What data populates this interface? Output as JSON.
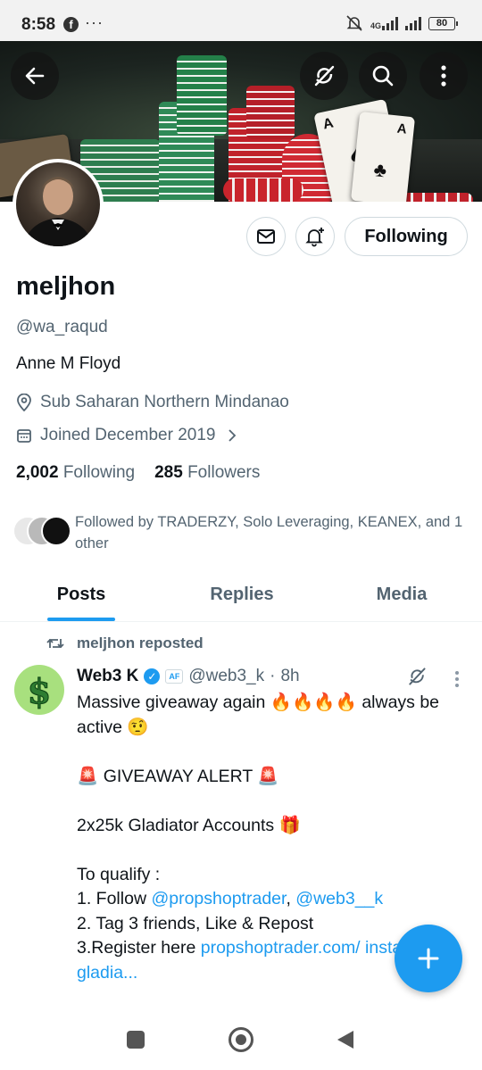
{
  "status_bar": {
    "time": "8:58",
    "dots": "···",
    "network": "4G",
    "battery": "80"
  },
  "profile": {
    "name": "meljhon",
    "handle": "@wa_raqud",
    "bio": "Anne M Floyd",
    "location": "Sub Saharan Northern Mindanao",
    "joined": "Joined December 2019",
    "following_count": "2,002",
    "following_label": "Following",
    "followers_count": "285",
    "followers_label": "Followers",
    "followed_by": "Followed by TRADERZY, Solo Leveraging, KEANEX, and 1 other",
    "follow_button": "Following"
  },
  "tabs": [
    {
      "label": "Posts"
    },
    {
      "label": "Replies"
    },
    {
      "label": "Media"
    }
  ],
  "post": {
    "repost_label": "meljhon reposted",
    "author_name": "Web3 K",
    "affiliate_badge": "AF",
    "author_handle": "@web3_k",
    "separator": "·",
    "time": "8h",
    "line1": "Massive giveaway again 🔥🔥🔥🔥 always be active 🤨",
    "line2": "🚨 GIVEAWAY ALERT 🚨",
    "line3": "2x25k Gladiator Accounts 🎁",
    "line4": "To qualify :",
    "line5_prefix": "1. Follow ",
    "mention1": "@propshoptrader",
    "comma": ", ",
    "mention2": "@web3__k",
    "line6": "2. Tag 3 friends, Like & Repost",
    "line7_prefix": "3.Register here ",
    "link": "propshoptrader.com/ instant-gladia..."
  },
  "colors": {
    "accent": "#1d9bf0",
    "text": "#0f1419",
    "muted": "#536471",
    "border": "#cfd9de"
  },
  "icons": {
    "header": [
      "back-arrow-icon",
      "grok-icon",
      "search-icon",
      "more-vertical-icon"
    ],
    "actions": [
      "mail-icon",
      "notification-bell-icon"
    ],
    "meta": [
      "location-icon",
      "calendar-icon",
      "chevron-right-icon"
    ],
    "post": [
      "repost-icon",
      "verified-icon",
      "grok-icon",
      "more-vertical-icon"
    ],
    "fab": "plus-icon",
    "nav": [
      "recents-square-icon",
      "home-circle-icon",
      "back-triangle-icon"
    ]
  }
}
